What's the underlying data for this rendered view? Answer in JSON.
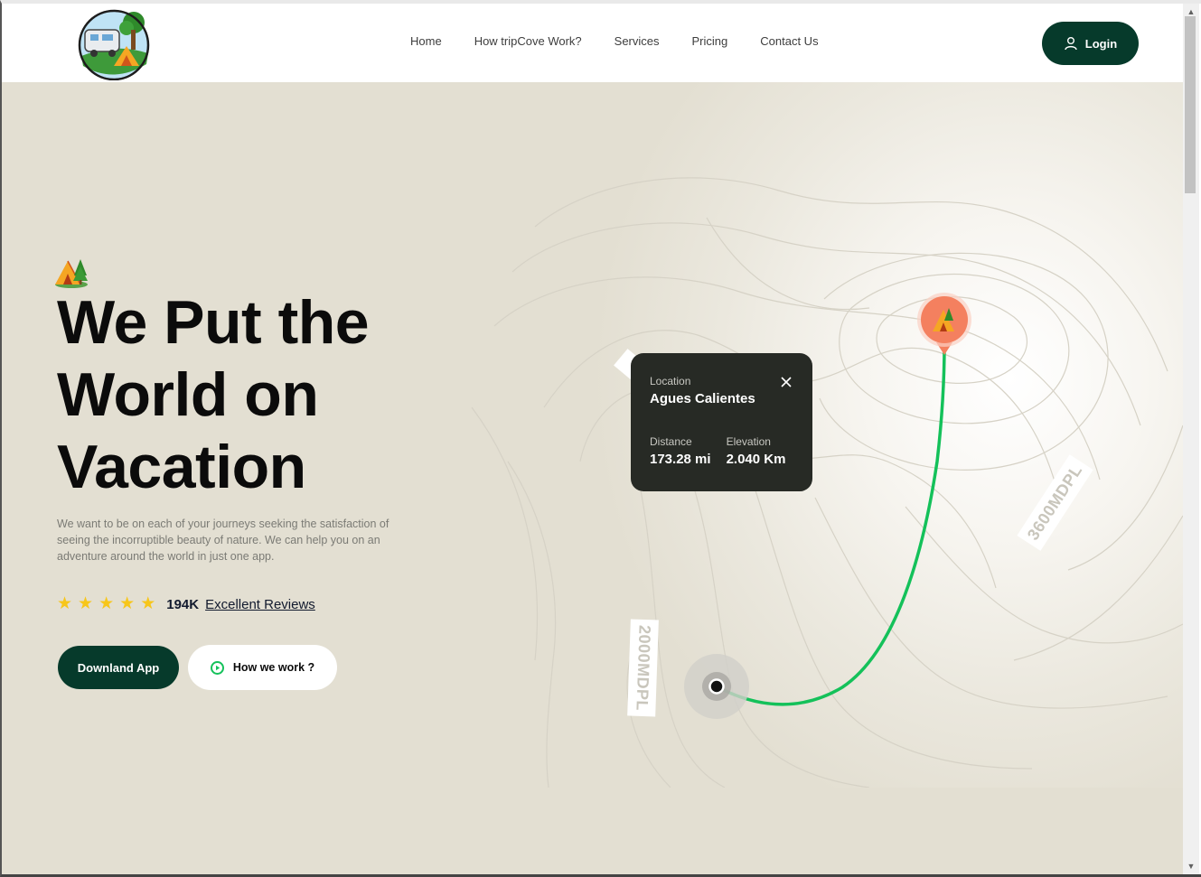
{
  "nav": {
    "items": [
      {
        "label": "Home"
      },
      {
        "label": "How tripCove Work?"
      },
      {
        "label": "Services"
      },
      {
        "label": "Pricing"
      },
      {
        "label": "Contact Us"
      }
    ],
    "login_label": "Login"
  },
  "hero": {
    "headline_lines": [
      "We Put the",
      "World on",
      "Vacation"
    ],
    "subtext": "We want to be on each of your journeys seeking the satisfaction of seeing the incorruptible beauty of nature. We can help you on an adventure around the world in just one app.",
    "rating": {
      "stars": 5,
      "count": "194K",
      "link_label": "Excellent Reviews"
    },
    "download_label": "Downland App",
    "how_label": "How we work ?"
  },
  "map": {
    "card": {
      "location_label": "Location",
      "location_value": "Agues Calientes",
      "distance_label": "Distance",
      "distance_value": "173.28 mi",
      "elevation_label": "Elevation",
      "elevation_value": "2.040 Km"
    },
    "elevation_tags": [
      "3600MDPL",
      "2000MDPL"
    ]
  },
  "colors": {
    "brand_dark": "#063a2b",
    "hero_bg": "#e3dfd2",
    "route_green": "#14c15a",
    "pin_orange": "#f4805f",
    "star_yellow": "#f7c61a",
    "card_bg": "#272a25"
  },
  "icons": {
    "logo": "camper-tent-logo",
    "login": "user-icon",
    "tent": "camping-tent-icon",
    "star": "star-icon",
    "play": "play-circle-icon",
    "close": "close-icon",
    "pin": "map-pin-icon",
    "origin": "origin-dot-icon"
  }
}
